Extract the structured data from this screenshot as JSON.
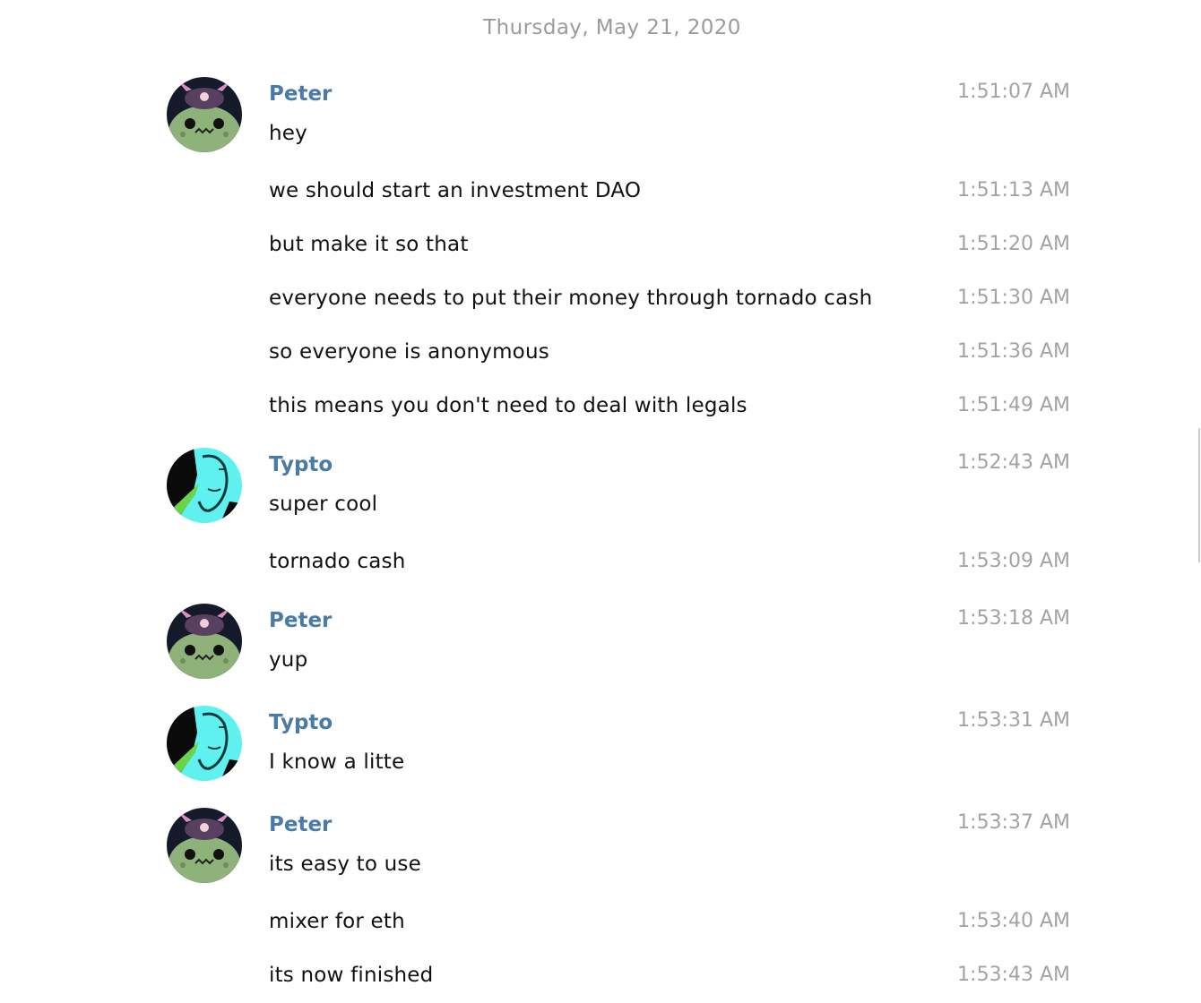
{
  "chat": {
    "date_header": "Thursday, May 21, 2020",
    "groups": [
      {
        "sender": "Peter",
        "avatar": "peter-avatar-icon",
        "messages": [
          {
            "text": "hey",
            "time": "1:51:07 AM"
          },
          {
            "text": "we should start an investment DAO",
            "time": "1:51:13 AM"
          },
          {
            "text": "but make it so that",
            "time": "1:51:20 AM"
          },
          {
            "text": "everyone needs to put their money through tornado cash",
            "time": "1:51:30 AM"
          },
          {
            "text": "so everyone is anonymous",
            "time": "1:51:36 AM"
          },
          {
            "text": "this means you don't need to deal with legals",
            "time": "1:51:49 AM"
          }
        ]
      },
      {
        "sender": "Typto",
        "avatar": "typto-avatar-icon",
        "messages": [
          {
            "text": "super cool",
            "time": "1:52:43 AM"
          },
          {
            "text": "tornado cash",
            "time": "1:53:09 AM"
          }
        ]
      },
      {
        "sender": "Peter",
        "avatar": "peter-avatar-icon",
        "messages": [
          {
            "text": "yup",
            "time": "1:53:18 AM"
          }
        ]
      },
      {
        "sender": "Typto",
        "avatar": "typto-avatar-icon",
        "messages": [
          {
            "text": "I know a litte",
            "time": "1:53:31 AM"
          }
        ]
      },
      {
        "sender": "Peter",
        "avatar": "peter-avatar-icon",
        "messages": [
          {
            "text": "its easy to use",
            "time": "1:53:37 AM"
          },
          {
            "text": "mixer for eth",
            "time": "1:53:40 AM"
          },
          {
            "text": "its now finished",
            "time": "1:53:43 AM"
          }
        ]
      }
    ]
  },
  "colors": {
    "sender_name": "#4a7aa6",
    "timestamp": "#a3a3a3",
    "date_header": "#9b9b9b",
    "message_text": "#111111"
  }
}
